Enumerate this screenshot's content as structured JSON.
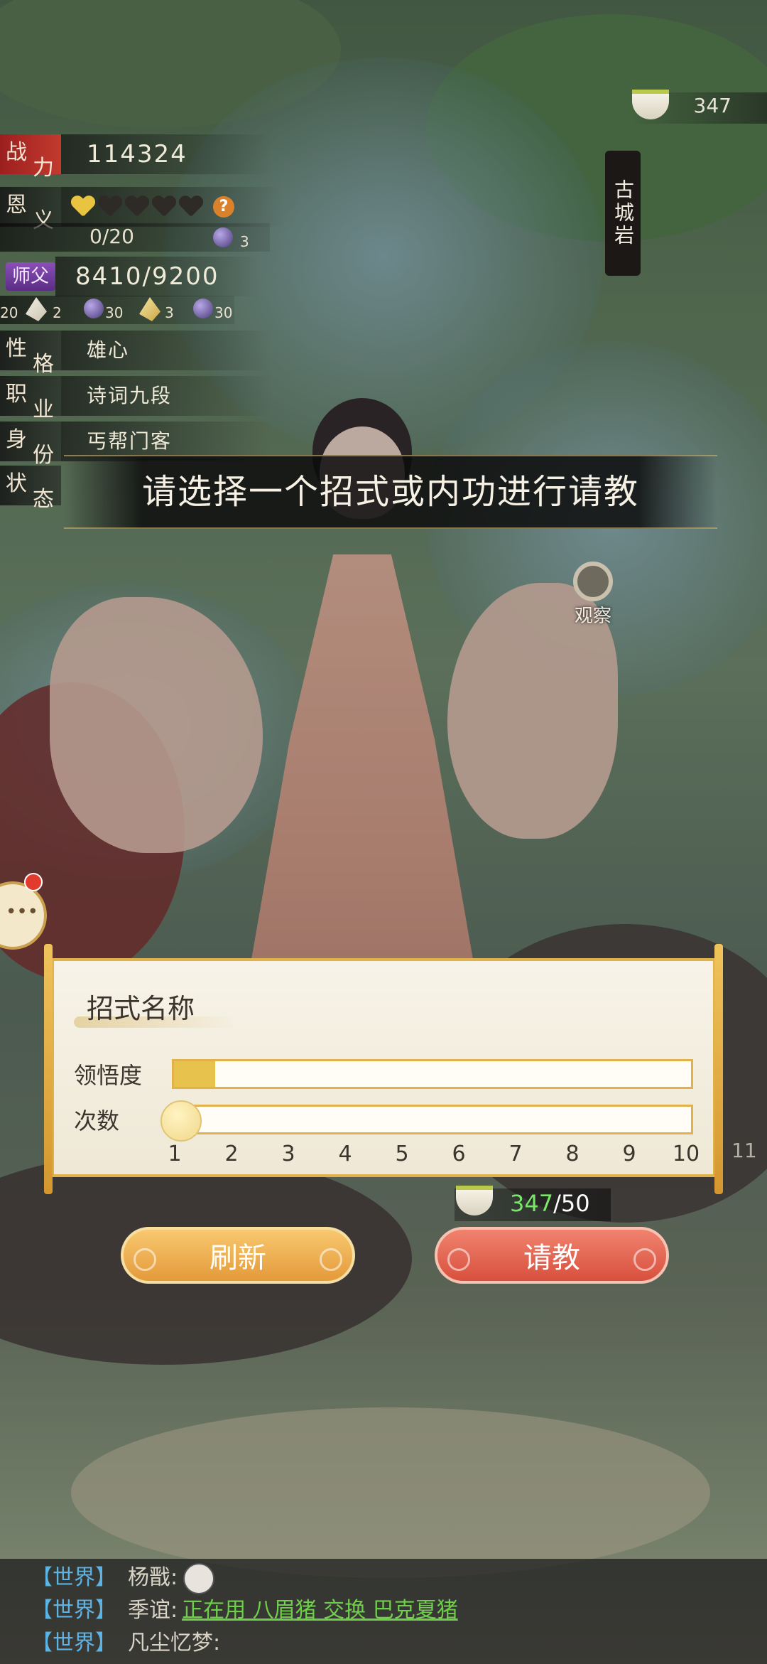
{
  "stats": {
    "combat": {
      "label_1": "战",
      "label_2": "力",
      "value": "114324"
    },
    "favor": {
      "label_1": "恩",
      "label_2": "义",
      "hearts_filled": 1,
      "hearts_total": 5,
      "help": "?",
      "progress": "0/20",
      "gem_count": "3"
    },
    "master": {
      "label": "师父",
      "value": "8410/9200"
    },
    "items": [
      {
        "icon": "feather-icon",
        "count": "20"
      },
      {
        "icon": "feather-icon",
        "count": "2"
      },
      {
        "icon": "gem-icon",
        "count": "30"
      },
      {
        "icon": "feather-gold-icon",
        "count": "3"
      },
      {
        "icon": "gem-icon",
        "count": "30"
      }
    ],
    "personality": {
      "label_1": "性",
      "label_2": "格",
      "value": "雄心"
    },
    "profession": {
      "label_1": "职",
      "label_2": "业",
      "value": "诗词九段"
    },
    "identity": {
      "label_1": "身",
      "label_2": "份",
      "value": "丐帮门客"
    },
    "status": {
      "label_1": "状",
      "label_2": "态"
    }
  },
  "tea_counter": "347",
  "name_banner": "古城岩",
  "observe_label": "观察",
  "instruction": "请选择一个招式或内功进行请教",
  "panel": {
    "skill_name": "招式名称",
    "comprehension_label": "领悟度",
    "comprehension_fraction": 0.08,
    "count_label": "次数",
    "ticks": [
      "1",
      "2",
      "3",
      "4",
      "5",
      "6",
      "7",
      "8",
      "9",
      "10"
    ],
    "tick_extra": "11"
  },
  "cost": {
    "have": "347",
    "need": "/50"
  },
  "buttons": {
    "refresh": "刷新",
    "ask": "请教"
  },
  "chat": [
    {
      "channel": "【世界】",
      "user": "杨戬:",
      "text": ""
    },
    {
      "channel": "【世界】",
      "user": "季谊:",
      "text": "正在用 八眉猪 交换 巴克夏猪"
    },
    {
      "channel": "【世界】",
      "user": "凡尘忆梦:",
      "text": ""
    }
  ],
  "colors": {
    "accent_gold": "#e1b24a",
    "refresh": "#e49a3a",
    "ask": "#d8503d",
    "have_green": "#7be46b"
  }
}
